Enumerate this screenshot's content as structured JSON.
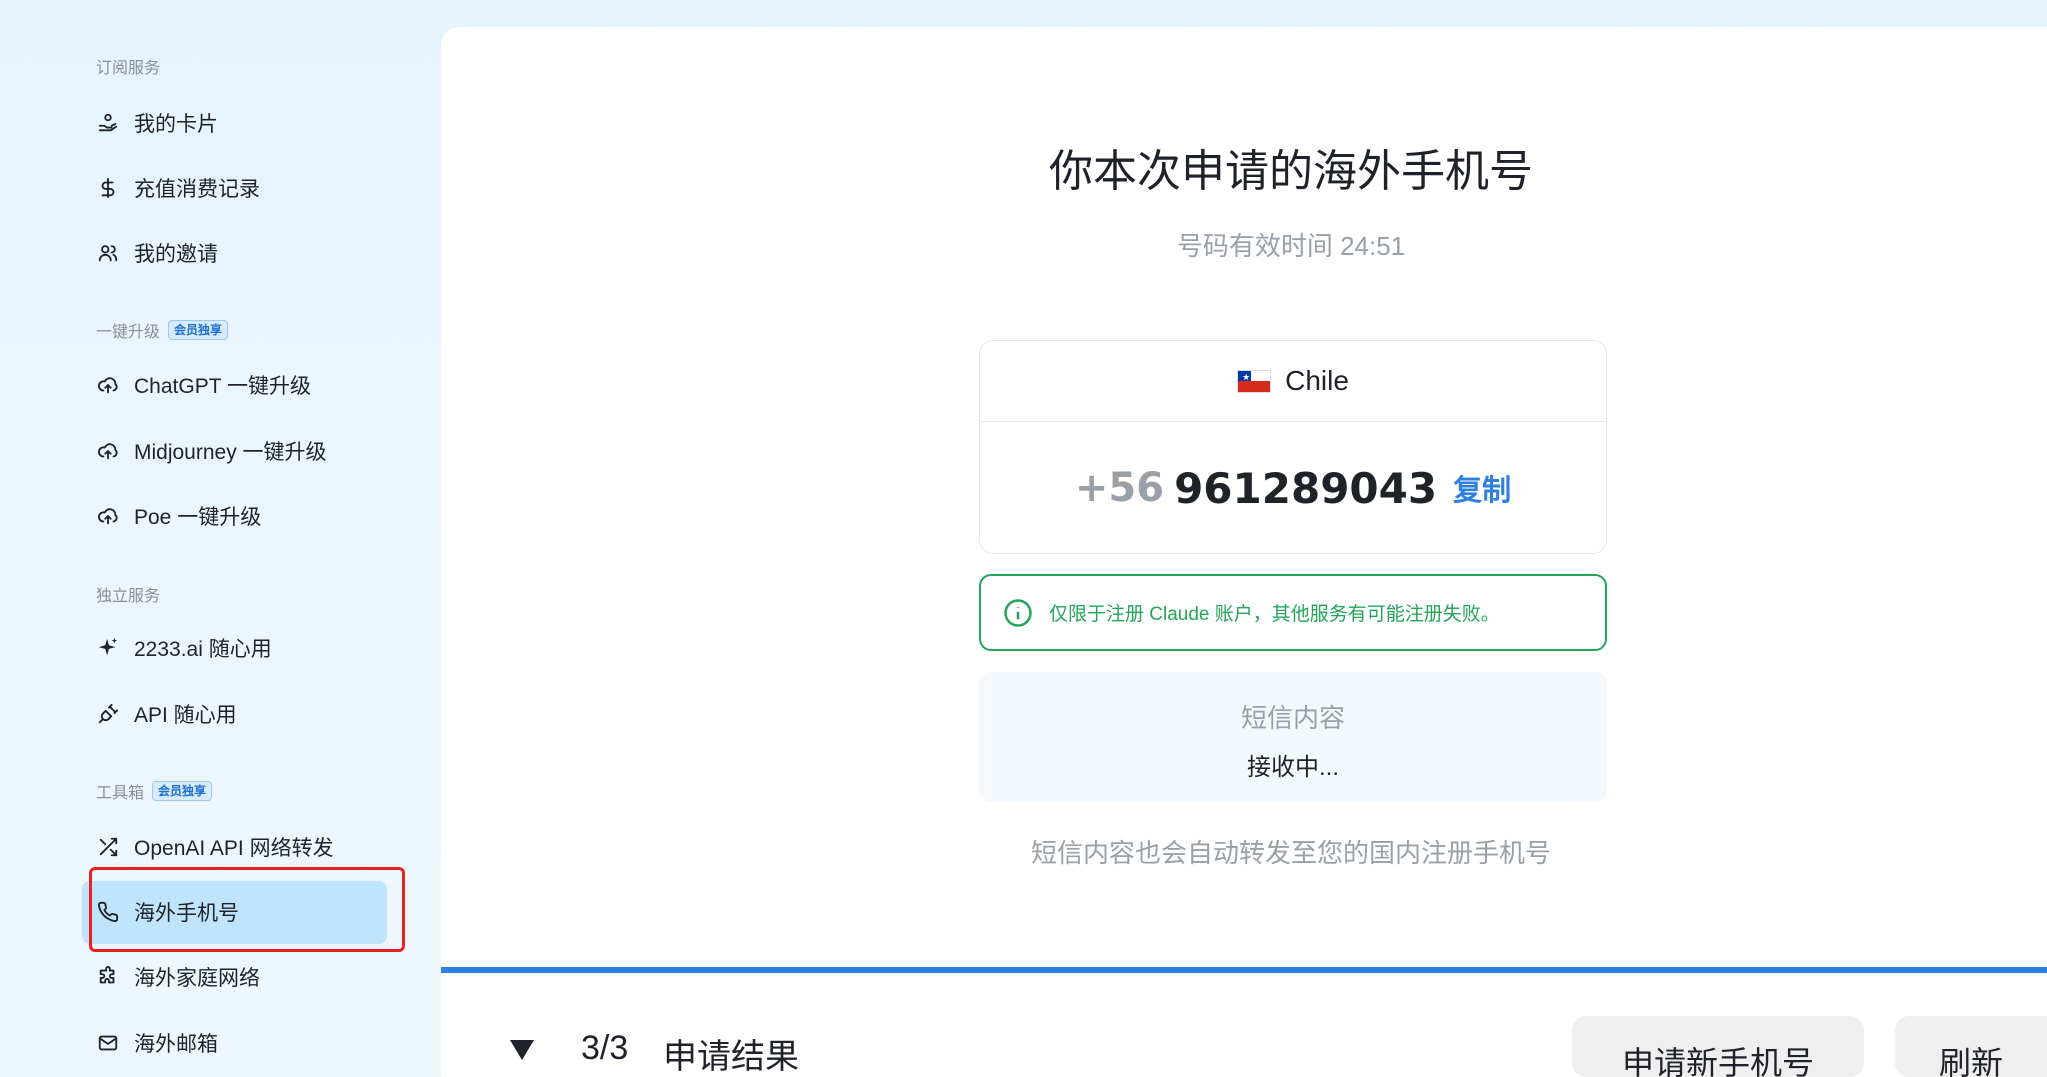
{
  "sidebar": {
    "sections": [
      {
        "title": "订阅服务"
      },
      {
        "title": "一键升级",
        "badge": "会员独享"
      },
      {
        "title": "独立服务"
      },
      {
        "title": "工具箱",
        "badge": "会员独享"
      }
    ],
    "items": [
      {
        "label": "我的卡片",
        "icon": "hand-coin-icon"
      },
      {
        "label": "充值消费记录",
        "icon": "dollar-icon"
      },
      {
        "label": "我的邀请",
        "icon": "users-icon"
      },
      {
        "label": "ChatGPT 一键升级",
        "icon": "cloud-upload-icon"
      },
      {
        "label": "Midjourney 一键升级",
        "icon": "cloud-upload-icon"
      },
      {
        "label": "Poe 一键升级",
        "icon": "cloud-upload-icon"
      },
      {
        "label": "2233.ai 随心用",
        "icon": "sparkle-icon"
      },
      {
        "label": "API 随心用",
        "icon": "plug-icon"
      },
      {
        "label": "OpenAI API 网络转发",
        "icon": "shuffle-icon"
      },
      {
        "label": "海外手机号",
        "icon": "phone-icon",
        "active": true
      },
      {
        "label": "海外家庭网络",
        "icon": "puzzle-icon"
      },
      {
        "label": "海外邮箱",
        "icon": "mail-icon"
      }
    ]
  },
  "main": {
    "title": "你本次申请的海外手机号",
    "validity": "号码有效时间 24:51",
    "country": "Chile",
    "country_code": "+56",
    "phone_number": "961289043",
    "copy_label": "复制",
    "notice": "仅限于注册 Claude 账户，其他服务有可能注册失败。",
    "sms_title": "短信内容",
    "sms_state": "接收中...",
    "forward_note": "短信内容也会自动转发至您的国内注册手机号"
  },
  "results": {
    "count": "3/3",
    "label": "申请结果",
    "new_button": "申请新手机号",
    "refresh_button": "刷新"
  },
  "colors": {
    "accent": "#2f7fe0",
    "success": "#23a55a",
    "highlight": "#e52320"
  }
}
